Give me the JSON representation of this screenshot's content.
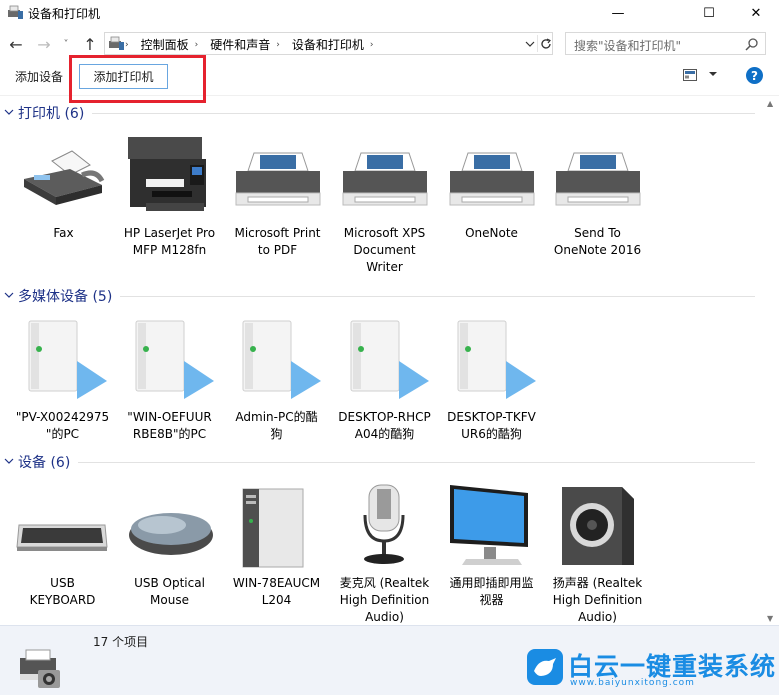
{
  "window": {
    "title": "设备和打印机",
    "minimize_glyph": "—",
    "maximize_glyph": "☐",
    "close_glyph": "✕"
  },
  "nav": {
    "back_glyph": "←",
    "forward_glyph": "→",
    "recent_glyph": "˅",
    "up_glyph": "↑",
    "breadcrumbs": [
      "控制面板",
      "硬件和声音",
      "设备和打印机"
    ],
    "breadcrumb_sep": "›",
    "dropdown_glyph": "⌄",
    "refresh_glyph": "↻",
    "search_placeholder": "搜索\"设备和打印机\""
  },
  "commands": {
    "add_device": "添加设备",
    "add_printer": "添加打印机",
    "help": "?"
  },
  "groups": {
    "printers": {
      "title": "打印机 (6)",
      "items": [
        {
          "l1": "Fax",
          "l2": "",
          "l3": "",
          "icon": "fax-icon"
        },
        {
          "l1": "HP LaserJet Pro",
          "l2": "MFP M128fn",
          "l3": "",
          "icon": "mfp-printer-icon"
        },
        {
          "l1": "Microsoft Print",
          "l2": "to PDF",
          "l3": "",
          "icon": "printer-icon"
        },
        {
          "l1": "Microsoft XPS",
          "l2": "Document",
          "l3": "Writer",
          "icon": "printer-icon"
        },
        {
          "l1": "OneNote",
          "l2": "",
          "l3": "",
          "icon": "printer-icon"
        },
        {
          "l1": "Send To",
          "l2": "OneNote 2016",
          "l3": "",
          "icon": "printer-icon"
        }
      ]
    },
    "media": {
      "title": "多媒体设备 (5)",
      "items": [
        {
          "l1": "\"PV-X00242975",
          "l2": "\"的PC",
          "icon": "media-server-icon"
        },
        {
          "l1": "\"WIN-OEFUUR",
          "l2": "RBE8B\"的PC",
          "icon": "media-server-icon"
        },
        {
          "l1": "Admin-PC的酷",
          "l2": "狗",
          "icon": "media-server-icon"
        },
        {
          "l1": "DESKTOP-RHCP",
          "l2": "A04的酷狗",
          "icon": "media-server-icon"
        },
        {
          "l1": "DESKTOP-TKFV",
          "l2": "UR6的酷狗",
          "icon": "media-server-icon"
        }
      ]
    },
    "devices": {
      "title": "设备 (6)",
      "items": [
        {
          "l1": "USB",
          "l2": "KEYBOARD",
          "l3": "",
          "icon": "keyboard-icon"
        },
        {
          "l1": "USB Optical",
          "l2": "Mouse",
          "l3": "",
          "icon": "mouse-icon"
        },
        {
          "l1": "WIN-78EAUCM",
          "l2": "L204",
          "l3": "",
          "icon": "computer-tower-icon"
        },
        {
          "l1": "麦克风 (Realtek",
          "l2": "High Definition",
          "l3": "Audio)",
          "icon": "microphone-icon"
        },
        {
          "l1": "通用即插即用监",
          "l2": "视器",
          "l3": "",
          "icon": "monitor-icon"
        },
        {
          "l1": "扬声器 (Realtek",
          "l2": "High Definition",
          "l3": "Audio)",
          "icon": "speaker-icon"
        }
      ]
    }
  },
  "status": {
    "item_count": "17 个项目"
  },
  "watermark": {
    "brand": "白云一键重装系统",
    "url": "www.baiyunxitong.com"
  },
  "colors": {
    "group_title": "#1e3287",
    "highlight_box": "#e5222e",
    "accent": "#1a8ce3"
  }
}
